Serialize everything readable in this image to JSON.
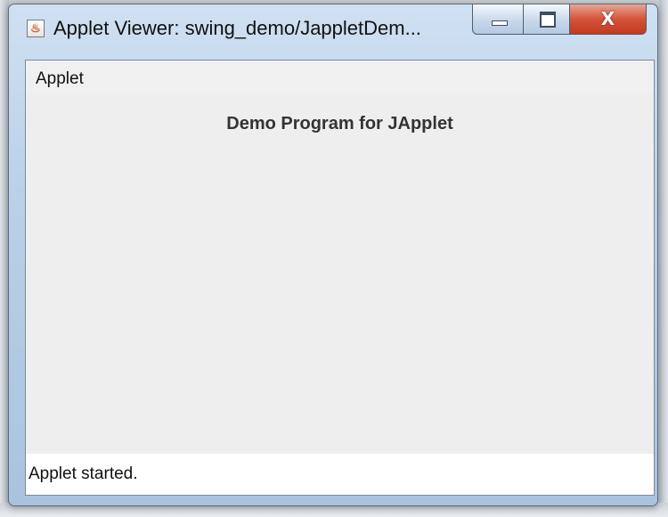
{
  "window": {
    "title": "Applet Viewer: swing_demo/JappletDem...",
    "app_icon": "java-cup-icon",
    "controls": {
      "minimize_icon": "minimize-icon",
      "maximize_icon": "maximize-icon",
      "close_label": "X"
    }
  },
  "menu": {
    "items": [
      {
        "label": "Applet"
      }
    ]
  },
  "applet": {
    "heading": "Demo Program for JApplet"
  },
  "status": {
    "text": "Applet started."
  },
  "colors": {
    "close_button": "#c23a20",
    "titlebar": "#b9d0e8",
    "client_background": "#eeeeee"
  }
}
